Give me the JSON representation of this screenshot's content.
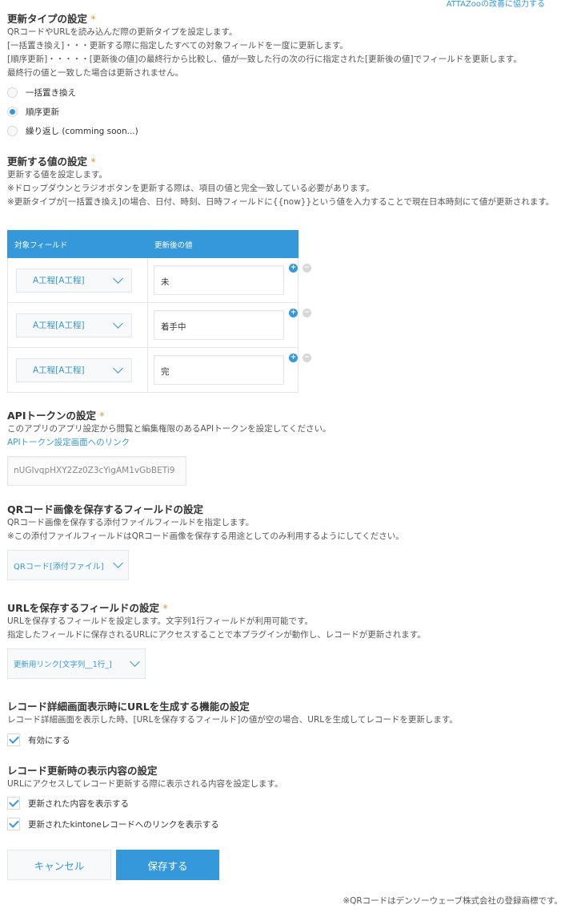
{
  "header": {
    "help_link": "ATTAZooの改善に協力する"
  },
  "update_type": {
    "title": "更新タイプの設定",
    "required_mark": "*",
    "desc": [
      "QRコードやURLを読み込んだ際の更新タイプを設定します。",
      "[一括置き換え]・・・更新する際に指定したすべての対象フィールドを一度に更新します。",
      "[順序更新]・・・・・[更新後の値]の最終行から比較し、値が一致した行の次の行に指定された[更新後の値]でフィールドを更新します。",
      "最終行の値と一致した場合は更新されません。"
    ],
    "options": [
      {
        "label": "一括置き換え",
        "selected": false
      },
      {
        "label": "順序更新",
        "selected": true
      },
      {
        "label": "繰り返し (comming soon...)",
        "selected": false
      }
    ]
  },
  "update_values": {
    "title": "更新する値の設定",
    "required_mark": "*",
    "desc": [
      "更新する値を設定します。",
      "※ドロップダウンとラジオボタンを更新する際は、項目の値と完全一致している必要があります。",
      "※更新タイプが[一括置き換え]の場合、日付、時刻、日時フィールドに{{now}}という値を入力することで現在日本時刻にて値が更新されます。"
    ],
    "table": {
      "col_field": "対象フィールド",
      "col_value": "更新後の値",
      "rows": [
        {
          "field": "A工程[A工程]",
          "value": "未"
        },
        {
          "field": "A工程[A工程]",
          "value": "着手中"
        },
        {
          "field": "A工程[A工程]",
          "value": "完"
        }
      ]
    }
  },
  "api_token": {
    "title": "APIトークンの設定",
    "required_mark": "*",
    "desc": "このアプリのアプリ設定から閲覧と編集権限のあるAPIトークンを設定してください。",
    "link": "APIトークン設定画面へのリンク",
    "value": "nUGIvqpHXY2Zz0Z3cYigAM1vGbBETi9"
  },
  "qr_field": {
    "title": "QRコード画像を保存するフィールドの設定",
    "desc": [
      "QRコード画像を保存する添付ファイルフィールドを指定します。",
      "※この添付ファイルフィールドはQRコード画像を保存する用途としてのみ利用するようにしてください。"
    ],
    "selected": "QRコード[添付ファイル]"
  },
  "url_field": {
    "title": "URLを保存するフィールドの設定",
    "required_mark": "*",
    "desc": [
      "URLを保存するフィールドを設定します。文字列1行フィールドが利用可能です。",
      "指定したフィールドに保存されるURLにアクセスすることで本プラグインが動作し、レコードが更新されます。"
    ],
    "selected": "更新用リンク[文字列__1行_]"
  },
  "url_generate": {
    "title": "レコード詳細画面表示時にURLを生成する機能の設定",
    "desc": "レコード詳細画面を表示した時、[URLを保存するフィールド]の値が空の場合、URLを生成してレコードを更新します。",
    "checkbox": "有効にする"
  },
  "display": {
    "title": "レコード更新時の表示内容の設定",
    "desc": "URLにアクセスしてレコード更新する際に表示される内容を設定します。",
    "checkboxes": [
      "更新された内容を表示する",
      "更新されたkintoneレコードへのリンクを表示する"
    ]
  },
  "buttons": {
    "cancel": "キャンセル",
    "save": "保存する"
  },
  "footer": "※QRコードはデンソーウェーブ株式会社の登録商標です。"
}
